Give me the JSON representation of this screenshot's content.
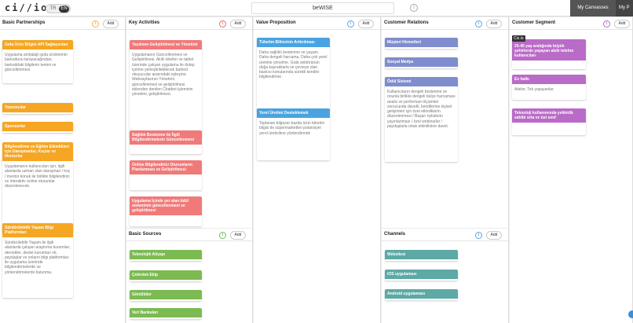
{
  "logo": "ci//io",
  "lang": {
    "tr": "TR",
    "en": "EN"
  },
  "project_name": "beWISE",
  "project_info": "i",
  "nav": {
    "canvases": "My Canvasses",
    "profile": "My P"
  },
  "add_label": "Add",
  "info_glyph": "i",
  "columns": {
    "partnerships": {
      "title": "Basic Partnerships",
      "cards": [
        {
          "head": "Gıda Ürün Bilgisi API Sağlayıcıları",
          "body": "Uygulama ambalajlı gıda ürünlerinin barkodunu tarayacağından, barkoddaki bilgilerin temini ve güncellenmesi."
        },
        {
          "head": "Yatırımcılar",
          "body": ""
        },
        {
          "head": "Sponsorlar",
          "body": ""
        },
        {
          "head": "Bilgilendirme ve Eğitim Etkinlikleri için Danışmanlar, Koçlar ve Mentorlar",
          "body": "Uygulamanın kullanıcıları için, ilgili alanlarda uzman olan danışman / koç / mentor konuk ile birlikte bilgilendirici ve interaktiv online oturumlar düzenlenecek."
        },
        {
          "head": "Sürdürülebilir Yaşam Bilgi Platformları",
          "body": "Sürdürülebilir Yaşam ile ilgili alanlarda çalışan araştırma kurumları, dernekler, devlet kurumları vb. paydaşlar ve onların bilgi platformları ile uygulama üzerinde bilgilendirmelerde ve yönlendirmelerde bulunma."
        }
      ]
    },
    "activities": {
      "title": "Key Activities",
      "cards": [
        {
          "head": "Yazılımın Geliştirilmesi ve Yönetimi",
          "body": "Uygulamanın Güncellenmesi ve Geliştirilmesi. Akıllı telefon ve tablet üzerinde çalışan uygulama ile dolap içerine yerleştirilebilecek barkod okuyucular arasındaki eşleşme. Websayfasının Yönetimi, güncellenmesi ve geliştirilmesi. eklenden denilen Chatbot işleminin yönetimi, geliştirilmesi."
        },
        {
          "head": "Sağlıklı Beslenme ile İlgili Bilgilendirmelerin Güncellenmesi",
          "body": ""
        },
        {
          "head": "Online Bilgilendirici Oturumların Planlanması ve Geliştirilmesi",
          "body": ""
        },
        {
          "head": "Uygulama İçinde yer alan ödül sisteminin güncellenmesi ve geliştirilmesi",
          "body": ""
        }
      ]
    },
    "resources": {
      "title": "Basic Sources",
      "cards": [
        {
          "head": "Teknolojik Altyapı"
        },
        {
          "head": "Çekirdek Ekip"
        },
        {
          "head": "Gönüllüler"
        },
        {
          "head": "Veri Bankaları"
        }
      ]
    },
    "value": {
      "title": "Value Proposition",
      "cards": [
        {
          "head": "Tüketim Bilincinin Arttırılması",
          "body": "Daha sağlıklı beslenme ve yaşam. Daha dengeli harcama. Daha çok yerel üretime yönelme. Gıda sektörünün doğa kaynaklarla ve çevreye olan baskısı konularında sürekli kendini bilgilendirme."
        },
        {
          "head": "Yerel Üretimi Desteklemek",
          "body": "Toplanan bilgeser bazda ürün tüketim bilgisi ile süpermarketleri potansiyel yerel üreticilere yönlendirmek"
        }
      ]
    },
    "relations": {
      "title": "Customer Relations",
      "cards": [
        {
          "head": "Müşteri Hizmetleri",
          "body": ""
        },
        {
          "head": "Sosyal Medya",
          "body": ""
        },
        {
          "head": "Ödül Sistemi",
          "body": "Kullanıcıların dengeli beslenme ve onunla birlikte dengeli bütçe harcaması analiz ve performan ölçümleri sonucunda davetli, kendilerine kişisel gelişimleri için özel etkinliklerin düzenlenmesi / Başarı öykülerin yayınlanması / özel webinarlar / paydaşlarla ortak etkinliklere davet."
        }
      ]
    },
    "channels": {
      "title": "Channels",
      "cards": [
        {
          "head": "Websitesi"
        },
        {
          "head": "iOS uygulaması"
        },
        {
          "head": "Android uygulaması"
        }
      ]
    },
    "segments": {
      "title": "Customer Segment",
      "tag": "Ciz.io",
      "cards": [
        {
          "head": "25-45 yaş aralığında büyük şehirlerde yaşayan akıllı telefon kullanıcıları",
          "body": ""
        },
        {
          "head": "Ev halkı",
          "body": "Aileler, Tek yaşayanlar."
        },
        {
          "head": "Teknoloji kullanımında yetkinlik sahibi orta ve üst sınıf",
          "body": ""
        }
      ]
    }
  },
  "colors": {
    "orange": "#f5a623",
    "red": "#f07a7a",
    "blue": "#4aa3e0",
    "slate": "#7f8dce",
    "purple": "#ba6bc7",
    "green": "#7cba52",
    "teal": "#5ca9a5"
  }
}
